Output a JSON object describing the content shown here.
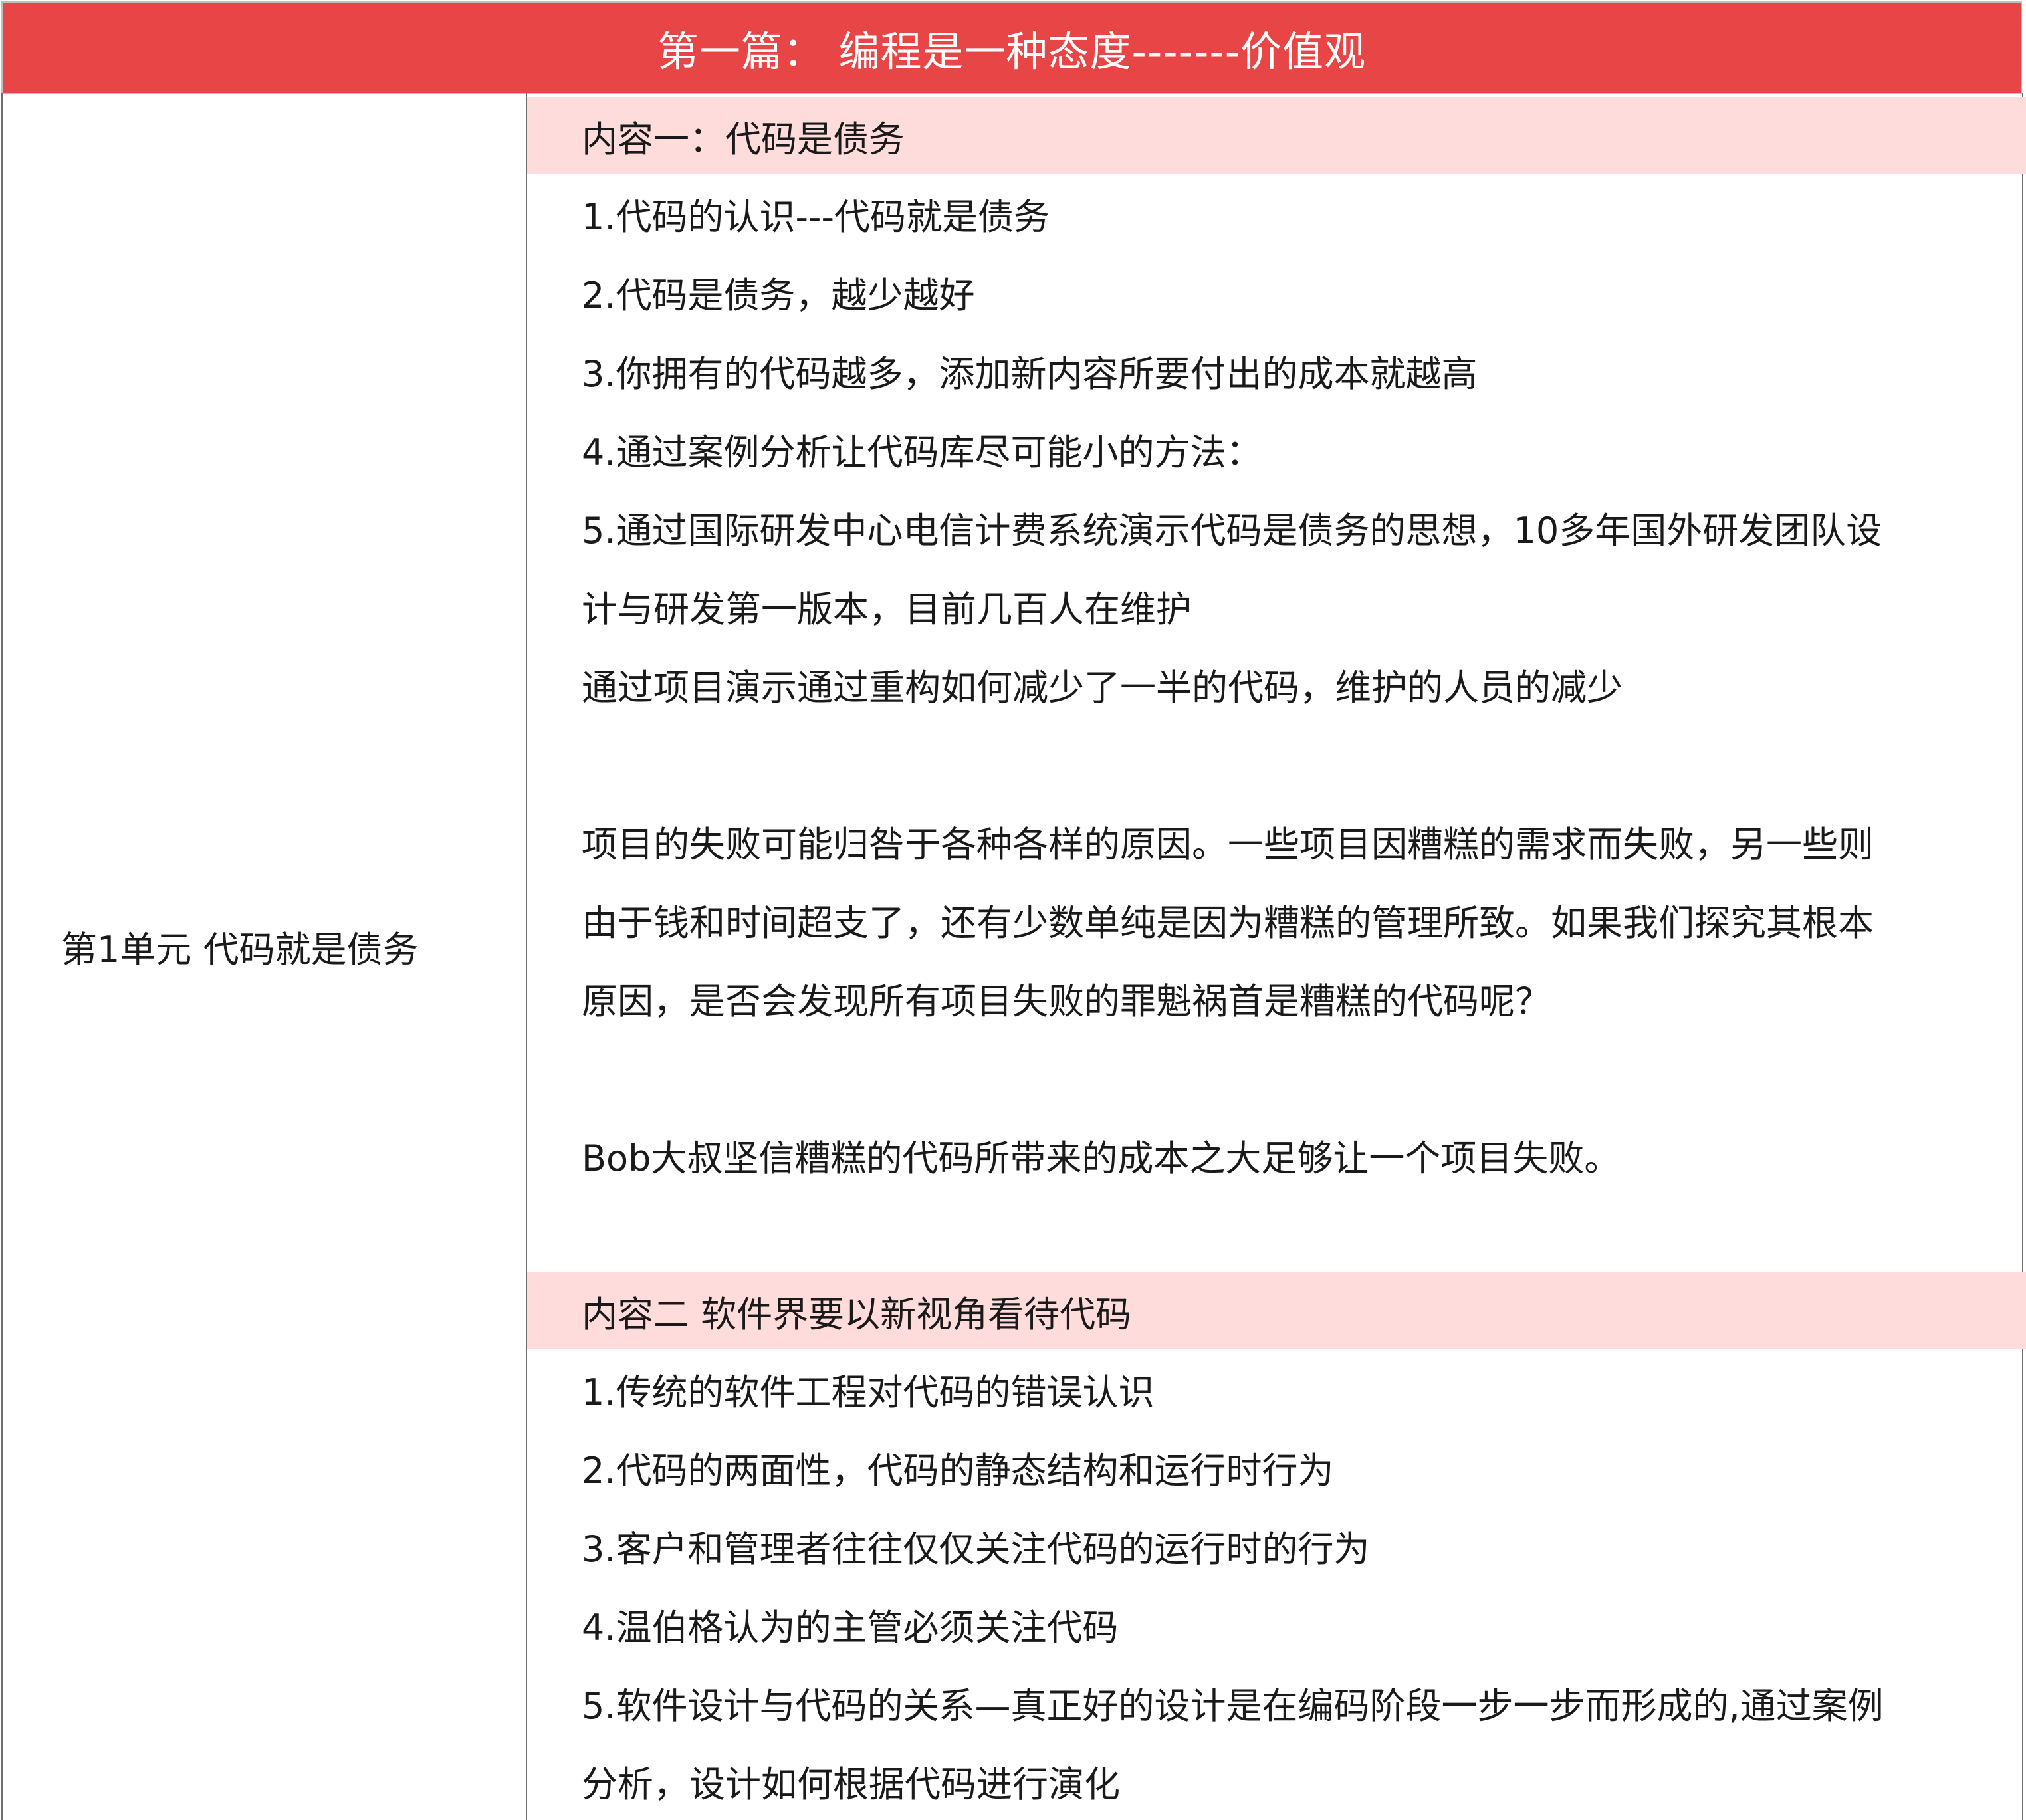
{
  "title": "第一篇： 编程是一种态度-------价值观",
  "unit": "第1单元  代码就是债务",
  "section1": {
    "header": "内容一：代码是债务",
    "lines": [
      "1.代码的认识---代码就是债务",
      "2.代码是债务，越少越好",
      "3.你拥有的代码越多，添加新内容所要付出的成本就越高",
      "4.通过案例分析让代码库尽可能小的方法：",
      "5.通过国际研发中心电信计费系统演示代码是债务的思想，10多年国外研发团队设",
      "计与研发第一版本，目前几百人在维护",
      "通过项目演示通过重构如何减少了一半的代码，维护的人员的减少"
    ],
    "para1": [
      "项目的失败可能归咎于各种各样的原因。一些项目因糟糕的需求而失败，另一些则",
      "由于钱和时间超支了，还有少数单纯是因为糟糕的管理所致。如果我们探究其根本",
      "原因，是否会发现所有项目失败的罪魁祸首是糟糕的代码呢？"
    ],
    "para2": "Bob大叔坚信糟糕的代码所带来的成本之大足够让一个项目失败。"
  },
  "section2": {
    "header": "内容二 软件界要以新视角看待代码",
    "lines": [
      "1.传统的软件工程对代码的错误认识",
      "2.代码的两面性，代码的静态结构和运行时行为",
      "3.客户和管理者往往仅仅关注代码的运行时的行为",
      "4.温伯格认为的主管必须关注代码",
      "5.软件设计与代码的关系—真正好的设计是在编码阶段一步一步而形成的,通过案例",
      "分析，设计如何根据代码进行演化"
    ]
  }
}
